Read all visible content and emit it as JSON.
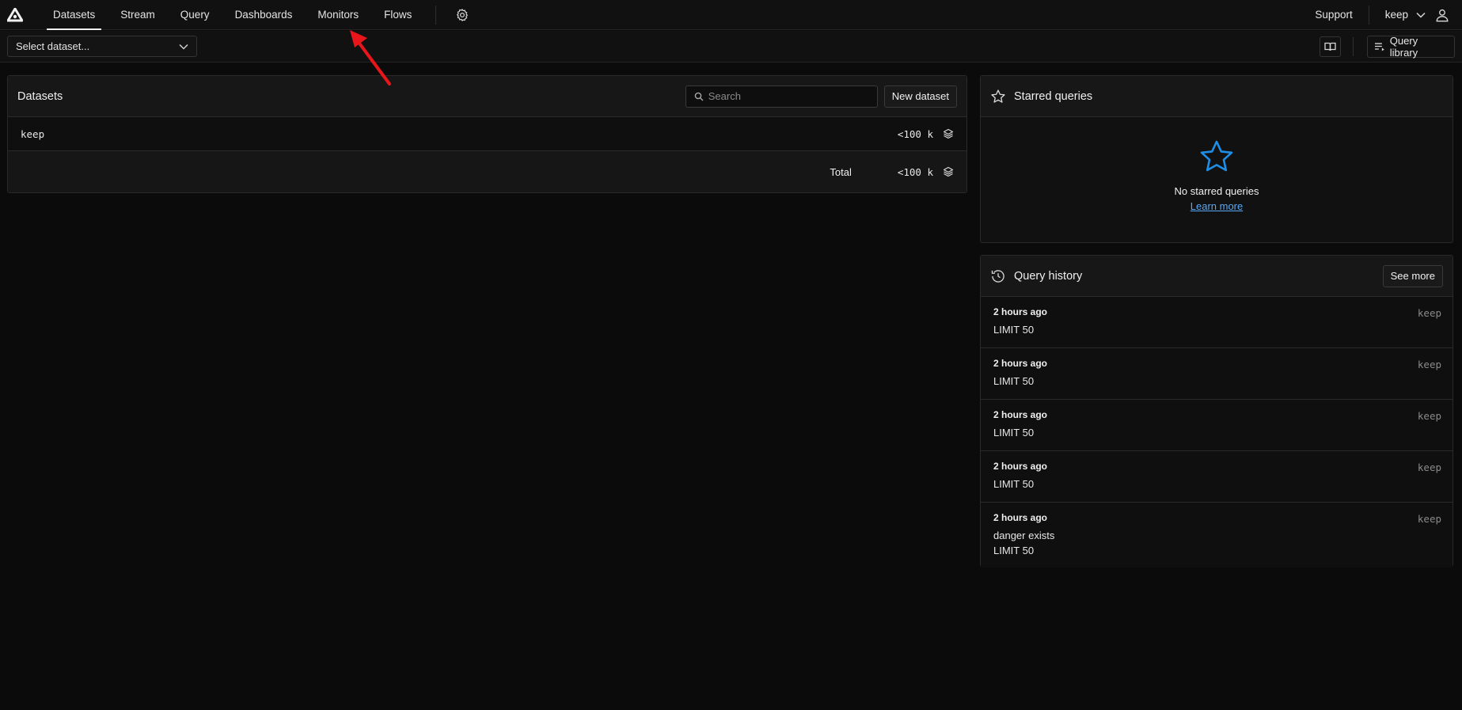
{
  "nav": {
    "items": [
      {
        "label": "Datasets",
        "active": true
      },
      {
        "label": "Stream"
      },
      {
        "label": "Query"
      },
      {
        "label": "Dashboards"
      },
      {
        "label": "Monitors"
      },
      {
        "label": "Flows"
      }
    ],
    "support": "Support",
    "user": "keep"
  },
  "subbar": {
    "dataset_select": "Select dataset...",
    "query_library": "Query library"
  },
  "datasets_panel": {
    "title": "Datasets",
    "search_placeholder": "Search",
    "new_button": "New dataset",
    "rows": [
      {
        "name": "keep",
        "count": "<100 k"
      }
    ],
    "total_label": "Total",
    "total_count": "<100 k"
  },
  "starred_panel": {
    "title": "Starred queries",
    "empty_text": "No starred queries",
    "learn_more": "Learn more"
  },
  "history_panel": {
    "title": "Query history",
    "see_more": "See more",
    "items": [
      {
        "time": "2 hours ago",
        "dataset": "keep",
        "lines": [
          "LIMIT 50"
        ]
      },
      {
        "time": "2 hours ago",
        "dataset": "keep",
        "lines": [
          "LIMIT 50"
        ]
      },
      {
        "time": "2 hours ago",
        "dataset": "keep",
        "lines": [
          "LIMIT 50"
        ]
      },
      {
        "time": "2 hours ago",
        "dataset": "keep",
        "lines": [
          "LIMIT 50"
        ]
      },
      {
        "time": "2 hours ago",
        "dataset": "keep",
        "lines": [
          "danger exists",
          "LIMIT 50"
        ]
      }
    ]
  },
  "colors": {
    "accent_star": "#1e8fe8",
    "link": "#5aa8f5",
    "annotation_arrow": "#e8151b"
  },
  "icons": [
    "app-logo-icon",
    "gear-icon",
    "chevron-down-icon",
    "user-icon",
    "book-icon",
    "query-library-icon",
    "search-icon",
    "layers-icon",
    "star-icon",
    "history-icon"
  ]
}
